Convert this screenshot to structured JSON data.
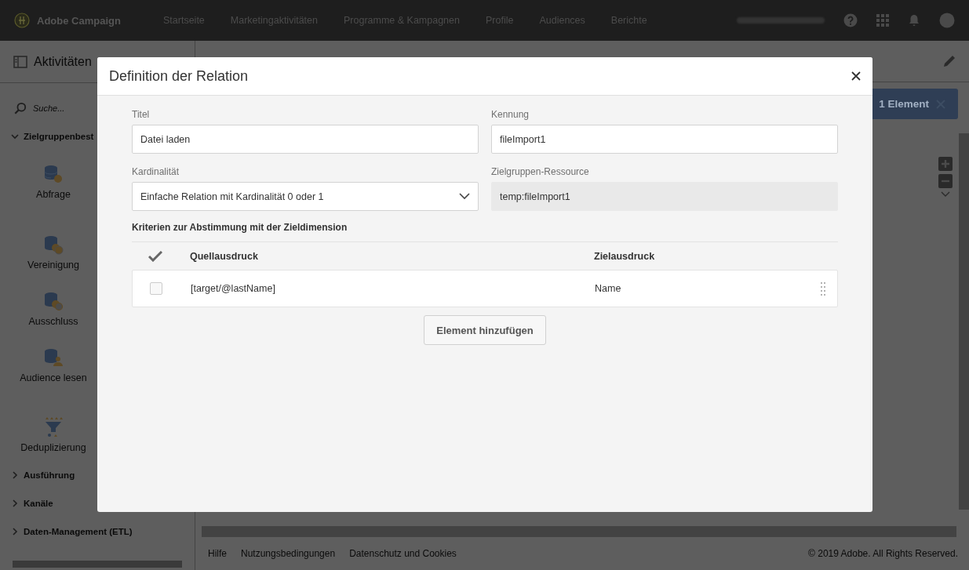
{
  "top_bar": {
    "product": "Adobe Campaign",
    "nav": [
      "Startseite",
      "Marketingaktivitäten",
      "Programme & Kampagnen",
      "Profile",
      "Audiences",
      "Berichte"
    ]
  },
  "sidebar": {
    "title": "Aktivitäten",
    "search": {
      "placeholder": "Suche..."
    },
    "sections": [
      {
        "label": "Zielgruppenbest",
        "expanded": true,
        "items": [
          {
            "label": "Abfrage",
            "kind": "query"
          },
          {
            "label": "Vereinigung",
            "kind": "union"
          },
          {
            "label": "Ausschluss",
            "kind": "exclusion"
          },
          {
            "label": "Audience lesen",
            "kind": "audience"
          },
          {
            "label": "Deduplizierung",
            "kind": "dedup"
          }
        ]
      },
      {
        "label": "Ausführung",
        "expanded": false
      },
      {
        "label": "Kanäle",
        "expanded": false
      },
      {
        "label": "Daten-Management (ETL)",
        "expanded": false
      }
    ]
  },
  "toolbar": {
    "selection_chip": "1 Element"
  },
  "footer": {
    "links": [
      "Hilfe",
      "Nutzungsbedingungen",
      "Datenschutz und Cookies"
    ],
    "copyright": "© 2019 Adobe. All Rights Reserved."
  },
  "dialog": {
    "title": "Definition der Relation",
    "fields": [
      {
        "label": "Titel",
        "kind": "text",
        "value": "Datei laden"
      },
      {
        "label": "Kennung",
        "kind": "text",
        "value": "fileImport1"
      },
      {
        "label": "Kardinalität",
        "kind": "select",
        "value": "Einfache Relation mit Kardinalität 0 oder 1"
      },
      {
        "label": "Zielgruppen-Ressource",
        "kind": "readonly",
        "value": "temp:fileImport1"
      }
    ],
    "criteria": {
      "title": "Kriterien zur Abstimmung mit der Zieldimension",
      "columns": [
        "Quellausdruck",
        "Zielausdruck"
      ],
      "rows": [
        {
          "checked": false,
          "source": "[target/@lastName]",
          "target": "Name"
        }
      ],
      "add_button": "Element hinzufügen"
    }
  }
}
